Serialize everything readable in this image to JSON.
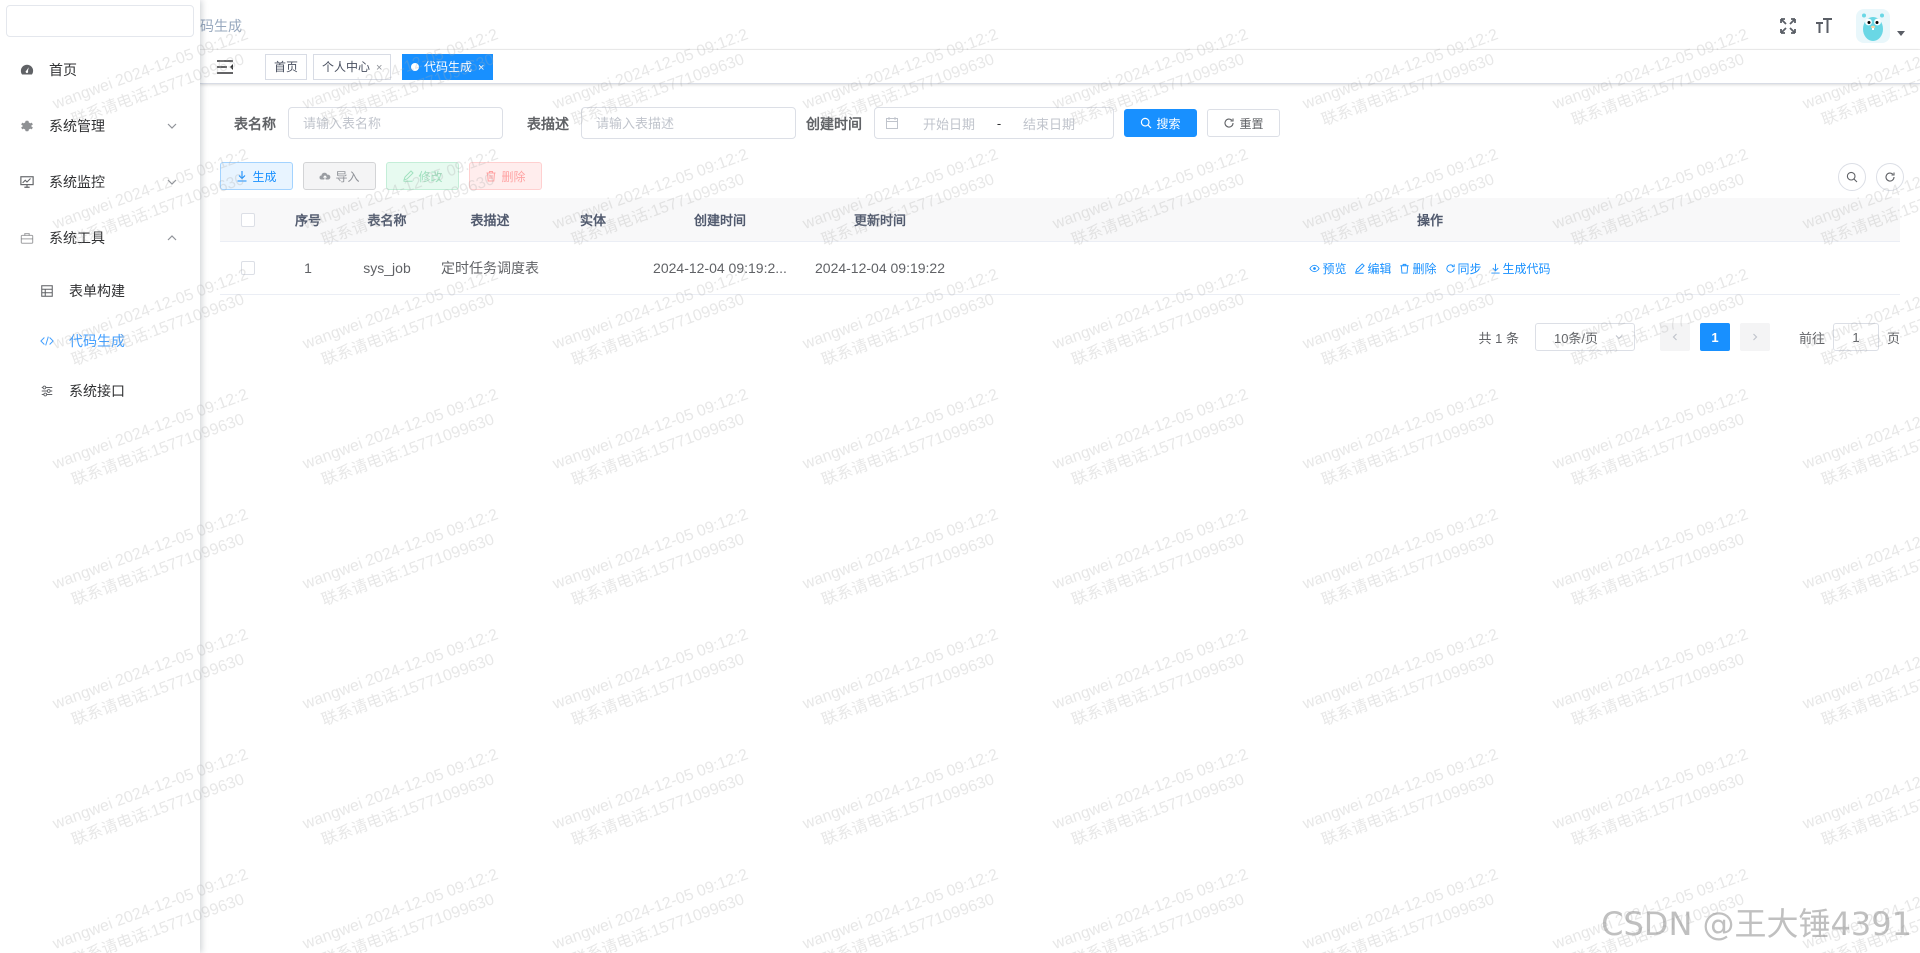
{
  "breadcrumb": {
    "current": "码生成"
  },
  "sidebar": {
    "items": [
      {
        "label": "首页"
      },
      {
        "label": "系统管理"
      },
      {
        "label": "系统监控"
      },
      {
        "label": "系统工具"
      }
    ],
    "subitems": [
      {
        "label": "表单构建"
      },
      {
        "label": "代码生成"
      },
      {
        "label": "系统接口"
      }
    ]
  },
  "tags": [
    {
      "label": "首页"
    },
    {
      "label": "个人中心",
      "close": "×"
    },
    {
      "label": "代码生成",
      "close": "×"
    }
  ],
  "search": {
    "table_name_label": "表名称",
    "table_name_placeholder": "请输入表名称",
    "table_desc_label": "表描述",
    "table_desc_placeholder": "请输入表描述",
    "create_time_label": "创建时间",
    "start_placeholder": "开始日期",
    "separator": "-",
    "end_placeholder": "结束日期",
    "search_label": "搜索",
    "reset_label": "重置"
  },
  "toolbar": {
    "generate": "生成",
    "import": "导入",
    "edit": "修改",
    "delete": "删除"
  },
  "table": {
    "headers": [
      "序号",
      "表名称",
      "表描述",
      "实体",
      "创建时间",
      "更新时间",
      "操作"
    ],
    "rows": [
      {
        "index": "1",
        "table_name": "sys_job",
        "table_desc": "定时任务调度表",
        "entity": "",
        "create_time": "2024-12-04 09:19:2...",
        "update_time": "2024-12-04 09:19:22"
      }
    ],
    "actions": [
      "预览",
      "编辑",
      "删除",
      "同步",
      "生成代码"
    ]
  },
  "pagination": {
    "total": "共 1 条",
    "page_size": "10条/页",
    "current_page": "1",
    "goto_prefix": "前往",
    "goto_value": "1",
    "goto_suffix": "页"
  },
  "watermark": {
    "line1": "wangwei 2024-12-05 09:12:2",
    "line2": "联系请电话:15771099630"
  },
  "csdn_mark": "CSDN @王大锤4391",
  "colors": {
    "primary": "#1890ff",
    "menu_active": "#409eff",
    "border": "#dcdfe6"
  }
}
